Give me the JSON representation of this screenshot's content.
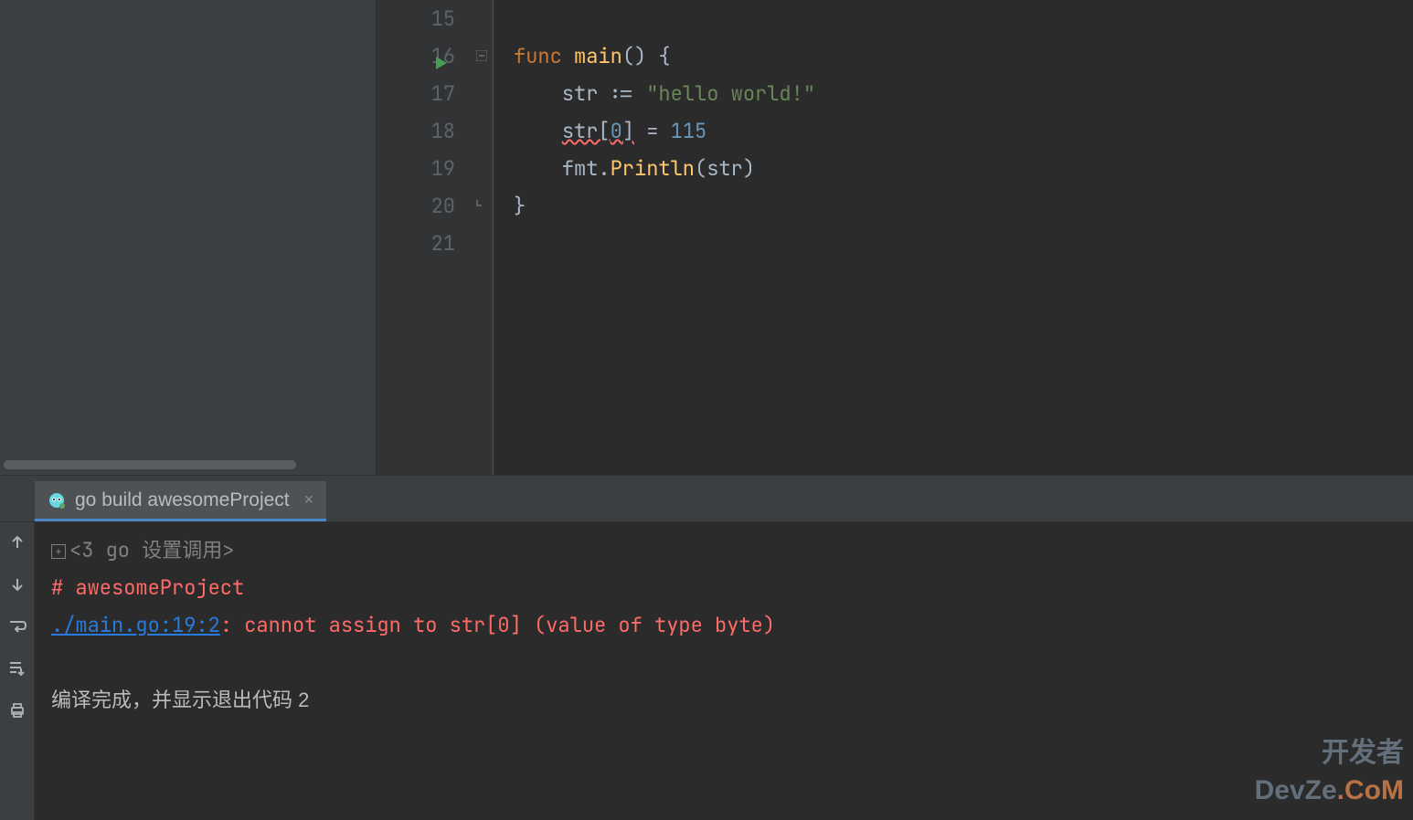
{
  "editor": {
    "lines": [
      {
        "num": "15",
        "tokens": []
      },
      {
        "num": "16",
        "tokens": [
          {
            "t": "func ",
            "c": "kw"
          },
          {
            "t": "main",
            "c": "fn"
          },
          {
            "t": "() {",
            "c": "punc"
          }
        ],
        "run_gutter": true,
        "fold": "minus"
      },
      {
        "num": "17",
        "tokens": [
          {
            "t": "    str ",
            "c": "ident"
          },
          {
            "t": ":=",
            "c": "punc"
          },
          {
            "t": " ",
            "c": "punc"
          },
          {
            "t": "\"hello world!\"",
            "c": "str"
          }
        ]
      },
      {
        "num": "18",
        "tokens": [
          {
            "t": "    ",
            "c": "punc"
          },
          {
            "t": "str[",
            "c": "ident",
            "err": true
          },
          {
            "t": "0",
            "c": "num",
            "err": true
          },
          {
            "t": "]",
            "c": "ident",
            "err": true
          },
          {
            "t": " = ",
            "c": "punc"
          },
          {
            "t": "115",
            "c": "num"
          }
        ]
      },
      {
        "num": "19",
        "tokens": [
          {
            "t": "    fmt.",
            "c": "ident"
          },
          {
            "t": "Println",
            "c": "fn"
          },
          {
            "t": "(str)",
            "c": "punc"
          }
        ]
      },
      {
        "num": "20",
        "tokens": [
          {
            "t": "}",
            "c": "punc"
          }
        ],
        "fold": "end"
      },
      {
        "num": "21",
        "tokens": []
      }
    ]
  },
  "run_tab": {
    "label": "go build awesomeProject"
  },
  "console": {
    "settings_line_prefix": "<3 go ",
    "settings_line_label": "设置调用",
    "header": "# awesomeProject",
    "error_link": "./main.go:19:2",
    "error_msg": ": cannot assign to str[0] (value of type byte)",
    "exit_line": "编译完成，并显示退出代码 2"
  },
  "icons": {
    "run": "▶",
    "close": "×",
    "up": "↑",
    "down": "↓",
    "wrap": "↩",
    "scroll_end": "⇲",
    "print": "🖶",
    "expand": "⊞"
  },
  "watermark": {
    "line1": "开发者",
    "line2a": "DevZe",
    "line2b": ".CoM"
  }
}
